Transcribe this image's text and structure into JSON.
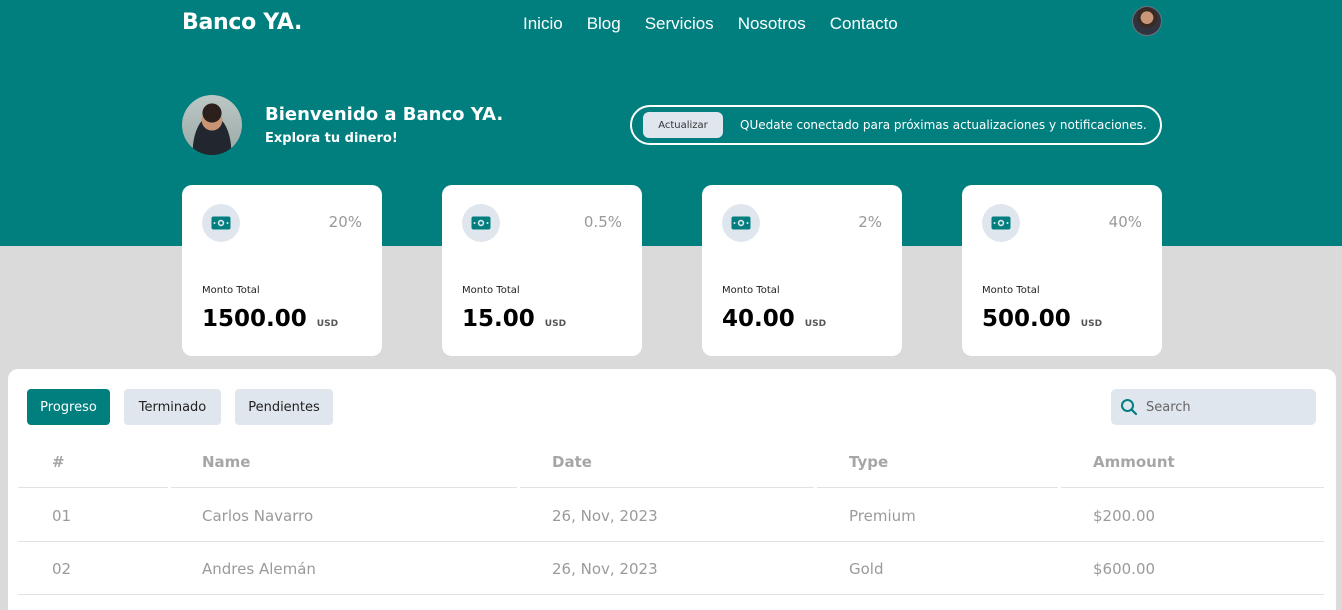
{
  "header": {
    "brand": "Banco YA.",
    "nav": [
      "Inicio",
      "Blog",
      "Servicios",
      "Nosotros",
      "Contacto"
    ]
  },
  "welcome": {
    "title": "Bienvenido a Banco YA.",
    "subtitle": "Explora tu dinero!"
  },
  "notice": {
    "button_label": "Actualizar",
    "text": "QUedate conectado para próximas actualizaciones y notificaciones."
  },
  "cards": [
    {
      "percent": "20%",
      "label": "Monto Total",
      "amount": "1500.00",
      "currency": "USD",
      "icon": "money-icon"
    },
    {
      "percent": "0.5%",
      "label": "Monto Total",
      "amount": "15.00",
      "currency": "USD",
      "icon": "money-icon"
    },
    {
      "percent": "2%",
      "label": "Monto Total",
      "amount": "40.00",
      "currency": "USD",
      "icon": "money-icon"
    },
    {
      "percent": "40%",
      "label": "Monto Total",
      "amount": "500.00",
      "currency": "USD",
      "icon": "money-icon"
    }
  ],
  "tabs": {
    "items": [
      "Progreso",
      "Terminado",
      "Pendientes"
    ],
    "active": "Progreso"
  },
  "search": {
    "placeholder": "Search"
  },
  "table": {
    "columns": [
      "#",
      "Name",
      "Date",
      "Type",
      "Ammount"
    ],
    "rows": [
      [
        "01",
        "Carlos Navarro",
        "26, Nov, 2023",
        "Premium",
        "$200.00"
      ],
      [
        "02",
        "Andres Alemán",
        "26, Nov, 2023",
        "Gold",
        "$600.00"
      ]
    ]
  },
  "colors": {
    "primary": "#017f7f",
    "background": "#dadada",
    "muted": "#dfe6ee"
  }
}
